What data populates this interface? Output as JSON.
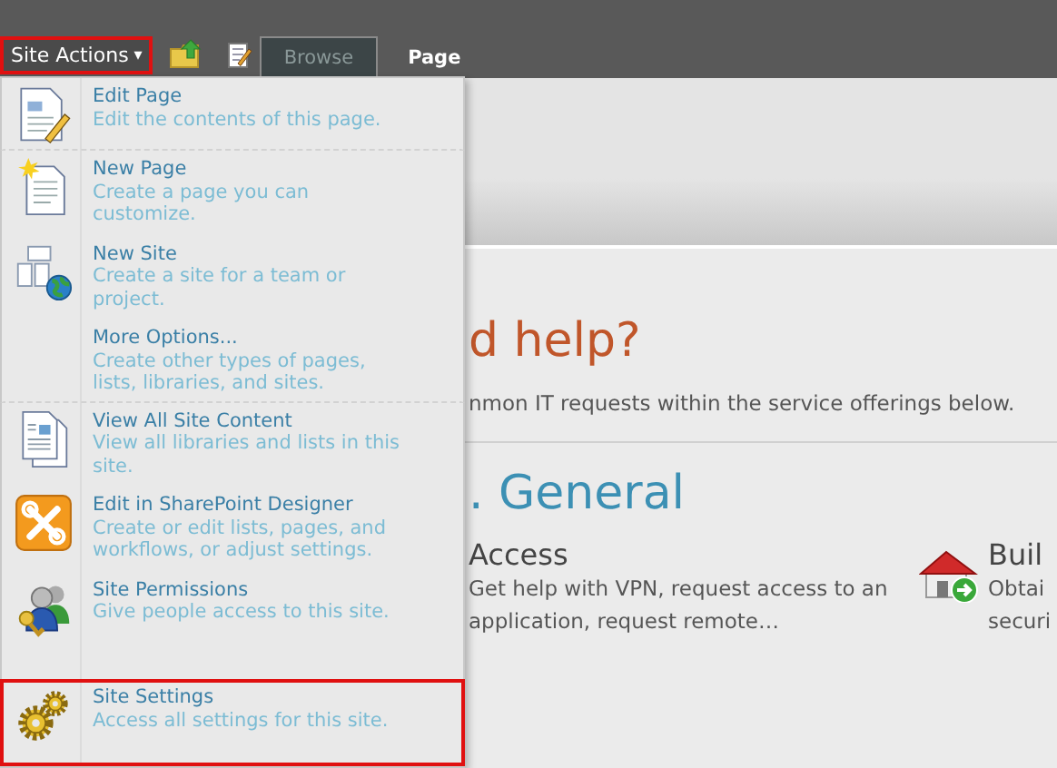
{
  "ribbon": {
    "site_actions": {
      "label": "Site Actions",
      "caret": "▾",
      "highlighted": true
    },
    "tabs": [
      {
        "label": "Browse",
        "selected": true
      },
      {
        "label": "Page",
        "selected": false
      }
    ]
  },
  "menu": {
    "items": [
      {
        "kind": "edit-page",
        "title": "Edit Page",
        "description": "Edit the contents of this page.",
        "highlighted": false,
        "separator_after": true
      },
      {
        "kind": "new-page",
        "title": "New Page",
        "description": "Create a page you can customize.",
        "highlighted": false,
        "separator_after": false
      },
      {
        "kind": "new-site",
        "title": "New Site",
        "description": "Create a site for a team or project.",
        "highlighted": false,
        "separator_after": false
      },
      {
        "kind": "none",
        "title": "More Options...",
        "description": "Create other types of pages, lists, libraries, and sites.",
        "highlighted": false,
        "separator_after": true
      },
      {
        "kind": "view-content",
        "title": "View All Site Content",
        "description": "View all libraries and lists in this site.",
        "highlighted": false,
        "separator_after": false
      },
      {
        "kind": "designer",
        "title": "Edit in SharePoint Designer",
        "description": "Create or edit lists, pages, and workflows, or adjust settings.",
        "highlighted": false,
        "separator_after": false
      },
      {
        "kind": "permissions",
        "title": "Site Permissions",
        "description": "Give people access to this site.",
        "highlighted": false,
        "separator_after": false
      },
      {
        "kind": "settings",
        "title": "Site Settings",
        "description": "Access all settings for this site.",
        "highlighted": true,
        "separator_after": false
      }
    ]
  },
  "content": {
    "heading": "d help?",
    "intro": "nmon IT requests within the service offerings below.",
    "section_title": ". General",
    "offerings": [
      {
        "kind": "none",
        "title": "Access",
        "description": "Get help with VPN, request access to an application, request remote…"
      },
      {
        "kind": "house",
        "title": "Buil",
        "description": "Obtai securi"
      }
    ]
  }
}
